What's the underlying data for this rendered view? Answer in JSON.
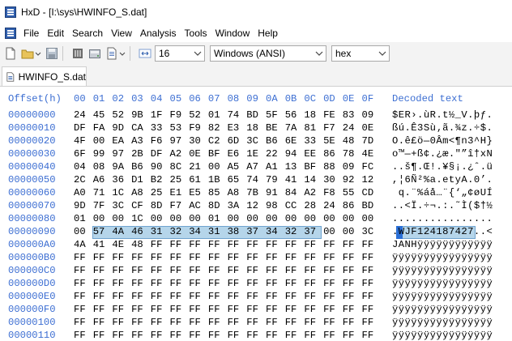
{
  "window": {
    "title": "HxD - [I:\\sys\\HWINFO_S.dat]"
  },
  "menu": [
    "File",
    "Edit",
    "Search",
    "View",
    "Analysis",
    "Tools",
    "Window",
    "Help"
  ],
  "toolbar": {
    "bytes_per_row": "16",
    "charset": "Windows (ANSI)",
    "display_mode": "hex"
  },
  "tab": {
    "label": "HWINFO_S.dat"
  },
  "editor": {
    "offset_header": "Offset(h)",
    "column_headers": [
      "00",
      "01",
      "02",
      "03",
      "04",
      "05",
      "06",
      "07",
      "08",
      "09",
      "0A",
      "0B",
      "0C",
      "0D",
      "0E",
      "0F"
    ],
    "decoded_header": "Decoded text",
    "rows": [
      {
        "offset": "00000000",
        "bytes": [
          "24",
          "45",
          "52",
          "9B",
          "1F",
          "F9",
          "52",
          "01",
          "74",
          "BD",
          "5F",
          "56",
          "18",
          "FE",
          "83",
          "09"
        ],
        "text": "$ER›.ùR.t½_V.þƒ."
      },
      {
        "offset": "00000010",
        "bytes": [
          "DF",
          "FA",
          "9D",
          "CA",
          "33",
          "53",
          "F9",
          "82",
          "E3",
          "18",
          "BE",
          "7A",
          "81",
          "F7",
          "24",
          "0E"
        ],
        "text": "ßú.Ê3Sù‚ã.¾z.÷$."
      },
      {
        "offset": "00000020",
        "bytes": [
          "4F",
          "00",
          "EA",
          "A3",
          "F6",
          "97",
          "30",
          "C2",
          "6D",
          "3C",
          "B6",
          "6E",
          "33",
          "5E",
          "48",
          "7D"
        ],
        "text": "O.ê£ö—0Âm<¶n3^H}"
      },
      {
        "offset": "00000030",
        "bytes": [
          "6F",
          "99",
          "97",
          "2B",
          "DF",
          "A2",
          "0E",
          "BF",
          "E6",
          "1E",
          "22",
          "94",
          "EE",
          "86",
          "78",
          "4E"
        ],
        "text": "o™—+ß¢.¿æ.\"”î†xN"
      },
      {
        "offset": "00000040",
        "bytes": [
          "04",
          "08",
          "9A",
          "B6",
          "90",
          "8C",
          "21",
          "00",
          "A5",
          "A7",
          "A1",
          "13",
          "BF",
          "88",
          "09",
          "FC"
        ],
        "text": "..š¶.Œ!.¥§¡.¿ˆ.ü"
      },
      {
        "offset": "00000050",
        "bytes": [
          "2C",
          "A6",
          "36",
          "D1",
          "B2",
          "25",
          "61",
          "1B",
          "65",
          "74",
          "79",
          "41",
          "14",
          "30",
          "92",
          "12"
        ],
        "text": ",¦6Ñ²%a.etyA.0’."
      },
      {
        "offset": "00000060",
        "bytes": [
          "A0",
          "71",
          "1C",
          "A8",
          "25",
          "E1",
          "E5",
          "85",
          "A8",
          "7B",
          "91",
          "84",
          "A2",
          "F8",
          "55",
          "CD"
        ],
        "text": " q.¨%áå…¨{‘„¢øUÍ"
      },
      {
        "offset": "00000070",
        "bytes": [
          "9D",
          "7F",
          "3C",
          "CF",
          "8D",
          "F7",
          "AC",
          "8D",
          "3A",
          "12",
          "98",
          "CC",
          "28",
          "24",
          "86",
          "BD"
        ],
        "text": "..<Ï.÷¬.:.˜Ì($†½"
      },
      {
        "offset": "00000080",
        "bytes": [
          "01",
          "00",
          "00",
          "1C",
          "00",
          "00",
          "00",
          "01",
          "00",
          "00",
          "00",
          "00",
          "00",
          "00",
          "00",
          "00"
        ],
        "text": "................"
      },
      {
        "offset": "00000090",
        "bytes": [
          "00",
          "57",
          "4A",
          "46",
          "31",
          "32",
          "34",
          "31",
          "38",
          "37",
          "34",
          "32",
          "37",
          "00",
          "00",
          "3C"
        ],
        "text": ".WJF124187427..<"
      },
      {
        "offset": "000000A0",
        "bytes": [
          "4A",
          "41",
          "4E",
          "48",
          "FF",
          "FF",
          "FF",
          "FF",
          "FF",
          "FF",
          "FF",
          "FF",
          "FF",
          "FF",
          "FF",
          "FF"
        ],
        "text": "JANHÿÿÿÿÿÿÿÿÿÿÿÿ"
      },
      {
        "offset": "000000B0",
        "bytes": [
          "FF",
          "FF",
          "FF",
          "FF",
          "FF",
          "FF",
          "FF",
          "FF",
          "FF",
          "FF",
          "FF",
          "FF",
          "FF",
          "FF",
          "FF",
          "FF"
        ],
        "text": "ÿÿÿÿÿÿÿÿÿÿÿÿÿÿÿÿ"
      },
      {
        "offset": "000000C0",
        "bytes": [
          "FF",
          "FF",
          "FF",
          "FF",
          "FF",
          "FF",
          "FF",
          "FF",
          "FF",
          "FF",
          "FF",
          "FF",
          "FF",
          "FF",
          "FF",
          "FF"
        ],
        "text": "ÿÿÿÿÿÿÿÿÿÿÿÿÿÿÿÿ"
      },
      {
        "offset": "000000D0",
        "bytes": [
          "FF",
          "FF",
          "FF",
          "FF",
          "FF",
          "FF",
          "FF",
          "FF",
          "FF",
          "FF",
          "FF",
          "FF",
          "FF",
          "FF",
          "FF",
          "FF"
        ],
        "text": "ÿÿÿÿÿÿÿÿÿÿÿÿÿÿÿÿ"
      },
      {
        "offset": "000000E0",
        "bytes": [
          "FF",
          "FF",
          "FF",
          "FF",
          "FF",
          "FF",
          "FF",
          "FF",
          "FF",
          "FF",
          "FF",
          "FF",
          "FF",
          "FF",
          "FF",
          "FF"
        ],
        "text": "ÿÿÿÿÿÿÿÿÿÿÿÿÿÿÿÿ"
      },
      {
        "offset": "000000F0",
        "bytes": [
          "FF",
          "FF",
          "FF",
          "FF",
          "FF",
          "FF",
          "FF",
          "FF",
          "FF",
          "FF",
          "FF",
          "FF",
          "FF",
          "FF",
          "FF",
          "FF"
        ],
        "text": "ÿÿÿÿÿÿÿÿÿÿÿÿÿÿÿÿ"
      },
      {
        "offset": "00000100",
        "bytes": [
          "FF",
          "FF",
          "FF",
          "FF",
          "FF",
          "FF",
          "FF",
          "FF",
          "FF",
          "FF",
          "FF",
          "FF",
          "FF",
          "FF",
          "FF",
          "FF"
        ],
        "text": "ÿÿÿÿÿÿÿÿÿÿÿÿÿÿÿÿ"
      },
      {
        "offset": "00000110",
        "bytes": [
          "FF",
          "FF",
          "FF",
          "FF",
          "FF",
          "FF",
          "FF",
          "FF",
          "FF",
          "FF",
          "FF",
          "FF",
          "FF",
          "FF",
          "FF",
          "FF"
        ],
        "text": "ÿÿÿÿÿÿÿÿÿÿÿÿÿÿÿÿ"
      }
    ]
  }
}
